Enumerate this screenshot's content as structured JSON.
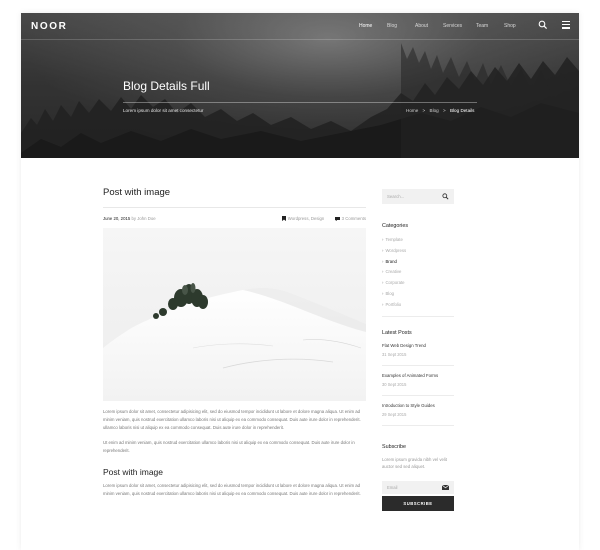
{
  "header": {
    "logo": "NOOR",
    "nav": [
      "Home",
      "Blog",
      "About",
      "Services",
      "Team",
      "Shop"
    ],
    "nav_active": "Home",
    "icons": [
      "search-icon",
      "hamburger-menu-icon"
    ]
  },
  "hero": {
    "title": "Blog Details Full",
    "subtitle": "Lorem ipsum dolor sit amet consectetur",
    "breadcrumb": {
      "home": "Home",
      "blog": "Blog",
      "current": "Blog Details",
      "separator": ">"
    }
  },
  "post": {
    "title": "Post with image",
    "date": "June 20, 2015",
    "by": "by",
    "author": "John Doe",
    "categories": "Wordpress, Design",
    "comments": "3 Comments",
    "paragraph1": "Lorem ipsum dolor sit amet, consectetur adipisicing elit, sed do eiusmod tempor incididunt ut labore et dolore magna aliqua. Ut enim ad minim veniam, quis nostrud exercitation ullamco laboris nisi ut aliquip ex ea commodo consequat. Duis aute irure dolor in reprehenderit. ullamco laboris nisi ut aliquip ex ea commodo consequat. Duis aute irure dolor in reprehenderit.",
    "paragraph2": "Ut enim ad minim veniam, quis nostrud exercitation ullamco laboris nisi ut aliquip ex ea commodo consequat. Duis aute irure dolor in reprehenderit.",
    "subheading": "Post with image",
    "paragraph3": "Lorem ipsum dolor sit amet, consectetur adipisicing elit, sed do eiusmod tempor incididunt ut labore et dolore magna aliqua. Ut enim ad minim veniam, quis nostrud exercitation ullamco laboris nisi ut aliquip ex ea commodo consequat. Duis aute irure dolor in reprehenderit."
  },
  "sidebar": {
    "search_placeholder": "Search...",
    "categories_title": "Categories",
    "categories": [
      "Template",
      "Wordpress",
      "Brand",
      "Creative",
      "Corporate",
      "Blog",
      "Portfolio"
    ],
    "categories_active": "Brand",
    "latest_title": "Latest Posts",
    "latest": [
      {
        "title": "Flat Web Design Trend",
        "date": "31 Sept 2015"
      },
      {
        "title": "Examples of Animated Forms",
        "date": "30 Sept 2015"
      },
      {
        "title": "Introduction to Style Guides",
        "date": "29 Sept 2015"
      }
    ],
    "subscribe_title": "Subscribe",
    "subscribe_text": "Lorem ipsum gravida nibh vel velit auctor sed sed aliquet.",
    "email_placeholder": "Email",
    "subscribe_button": "SUBSCRIBE"
  }
}
